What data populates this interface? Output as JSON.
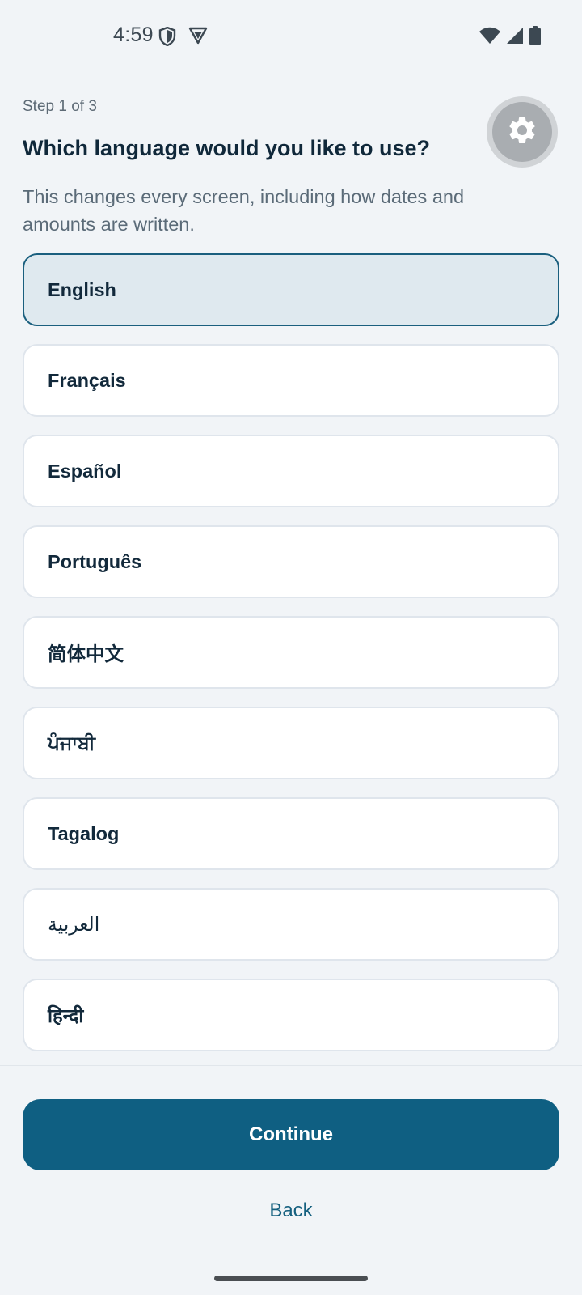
{
  "status_bar": {
    "time": "4:59",
    "icons": [
      "shield-icon",
      "vpn-icon",
      "wifi-icon",
      "cellular-signal-icon",
      "battery-icon"
    ]
  },
  "header": {
    "step": "Step 1 of 3",
    "title": "Which language would you like to use?",
    "subtitle": "This changes every screen, including how dates and amounts are written.",
    "settings_icon": "gear-icon"
  },
  "languages": [
    {
      "label": "English",
      "selected": true
    },
    {
      "label": "Français",
      "selected": false
    },
    {
      "label": "Español",
      "selected": false
    },
    {
      "label": "Português",
      "selected": false
    },
    {
      "label": "简体中文",
      "selected": false
    },
    {
      "label": "ਪੰਜਾਬੀ",
      "selected": false
    },
    {
      "label": "Tagalog",
      "selected": false
    },
    {
      "label": "العربية",
      "selected": false
    },
    {
      "label": "हिन्दी",
      "selected": false
    }
  ],
  "actions": {
    "continue_label": "Continue",
    "back_label": "Back"
  },
  "colors": {
    "primary": "#0f5f82",
    "selected_bg": "#dfe9ef",
    "background": "#f1f4f7"
  }
}
